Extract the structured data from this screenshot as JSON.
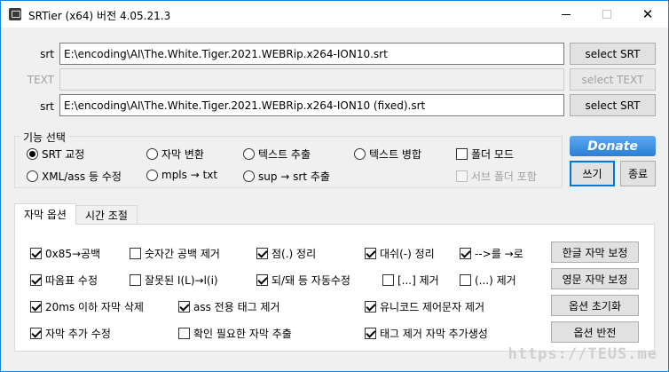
{
  "window": {
    "title": "SRTier (x64) 버전 4.05.21.3"
  },
  "files": {
    "srt_label": "srt",
    "text_label": "TEXT",
    "out_label": "srt",
    "srt_value": "E:\\encoding\\AI\\The.White.Tiger.2021.WEBRip.x264-ION10.srt",
    "text_value": "",
    "out_value": "E:\\encoding\\AI\\The.White.Tiger.2021.WEBRip.x264-ION10 (fixed).srt",
    "select_srt": "select SRT",
    "select_text": "select TEXT",
    "select_out": "select SRT"
  },
  "functions": {
    "title": "기능 선택",
    "radio_srt": "SRT 교정",
    "radio_sub_convert": "자막 변환",
    "radio_text_extract": "텍스트 추출",
    "radio_text_merge": "텍스트 병합",
    "radio_xml": "XML/ass 등 수정",
    "radio_mpls": "mpls → txt",
    "radio_sup": "sup → srt 추출",
    "check_folder_mode": "폴더 모드",
    "check_subfolder": "서브 폴더 포함"
  },
  "actions": {
    "donate": "Donate",
    "write": "쓰기",
    "exit": "종료"
  },
  "tabs": {
    "subtitle_options": "자막 옵션",
    "time_adjust": "시간 조절"
  },
  "options": {
    "o1": "0x85→공백",
    "o2": "숫자간 공백 제거",
    "o3": "점(.) 정리",
    "o4": "대쉬(-) 정리",
    "o5": "-->를 →로",
    "o6": "따옴표 수정",
    "o7": "잘못된 I(L)→l(i)",
    "o8": "되/돼 등 자동수정",
    "o9": "[...] 제거",
    "o10": "(...) 제거",
    "o11": "20ms 이하 자막 삭제",
    "o12": "ass 전용 태그 제거",
    "o13": "유니코드 제어문자 제거",
    "o14": "자막 추가 수정",
    "o15": "확인 필요한 자막 추출",
    "o16": "태그 제거 자막 추가생성",
    "btn_korean": "한글 자막 보정",
    "btn_english": "영문 자막 보정",
    "btn_reset": "옵션 초기화",
    "btn_invert": "옵션 반전"
  },
  "watermark": "https://TEUS.me"
}
